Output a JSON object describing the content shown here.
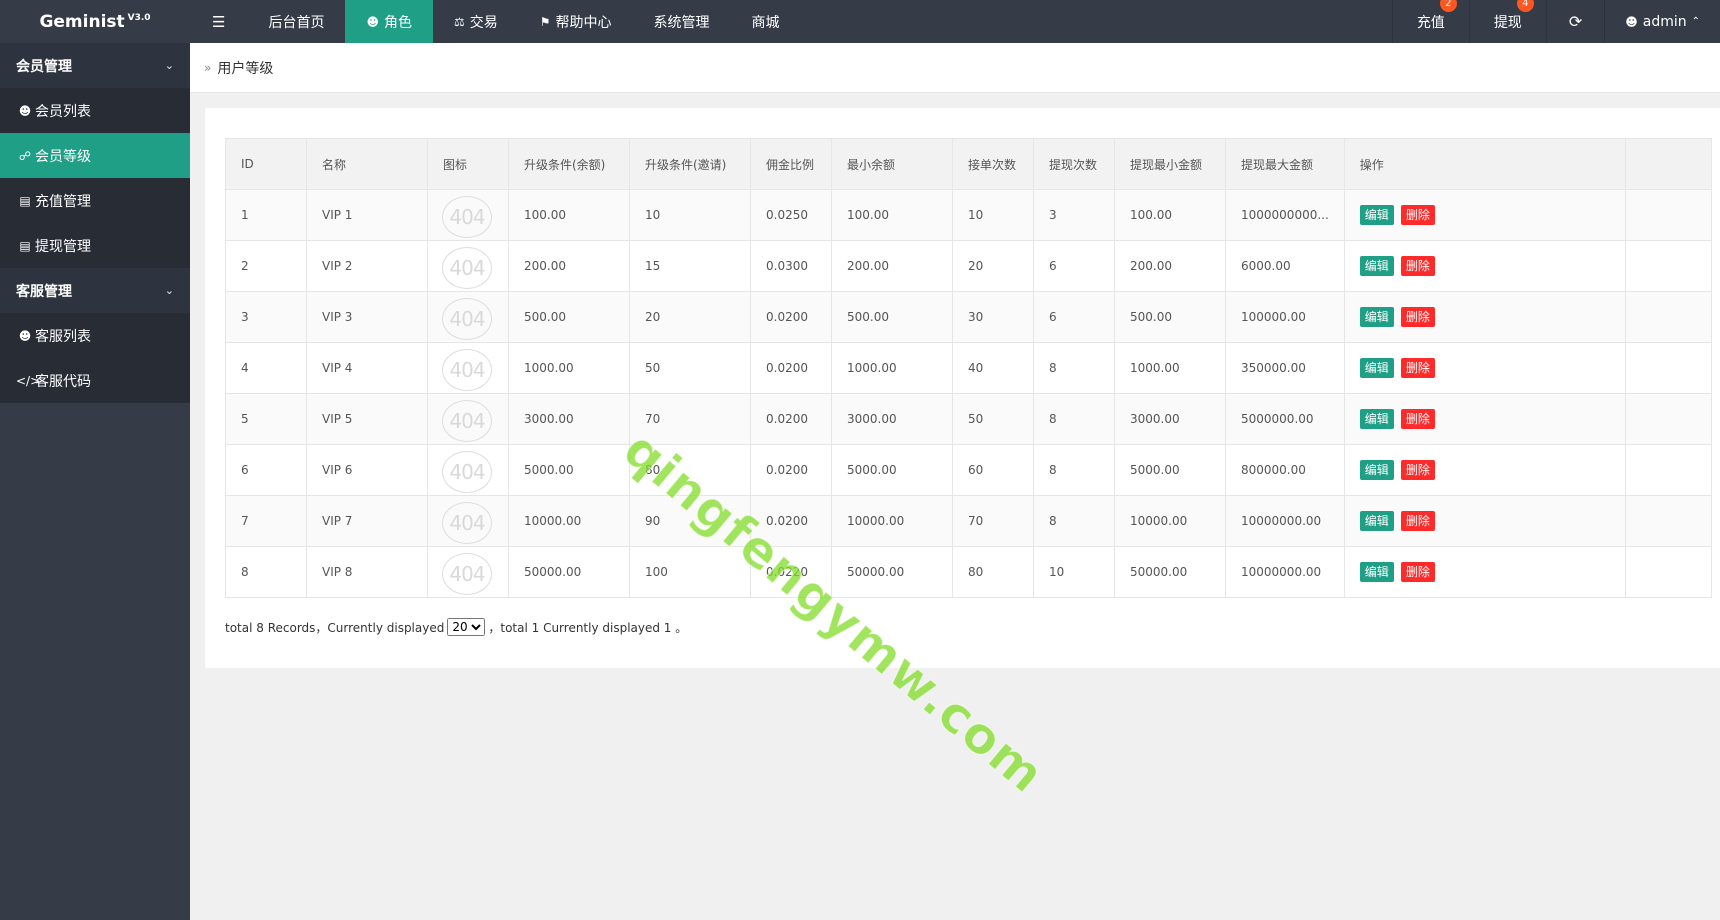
{
  "brand": {
    "name": "Geminist",
    "version": "V3.0"
  },
  "topnav": {
    "toggle_icon": "menu-toggle-icon",
    "items": [
      {
        "label": "后台首页",
        "icon": ""
      },
      {
        "label": "角色",
        "icon": "user-icon",
        "active": true
      },
      {
        "label": "交易",
        "icon": "balance-icon"
      },
      {
        "label": "帮助中心",
        "icon": "flag-icon"
      },
      {
        "label": "系统管理",
        "icon": ""
      },
      {
        "label": "商城",
        "icon": ""
      }
    ]
  },
  "topright": {
    "recharge": {
      "label": "充值",
      "badge": "2"
    },
    "withdraw": {
      "label": "提现",
      "badge": "4"
    },
    "user": "admin"
  },
  "sidebar": {
    "groups": [
      {
        "label": "会员管理",
        "items": [
          {
            "label": "会员列表",
            "icon": "user-icon"
          },
          {
            "label": "会员等级",
            "icon": "link-icon",
            "active": true
          },
          {
            "label": "充值管理",
            "icon": "card-icon"
          },
          {
            "label": "提现管理",
            "icon": "card-icon"
          }
        ]
      },
      {
        "label": "客服管理",
        "items": [
          {
            "label": "客服列表",
            "icon": "users-icon"
          },
          {
            "label": "客服代码",
            "icon": "code-icon"
          }
        ]
      }
    ]
  },
  "breadcrumb": "用户等级",
  "table": {
    "headers": [
      "ID",
      "名称",
      "图标",
      "升级条件(余额)",
      "升级条件(邀请)",
      "佣金比例",
      "最小余额",
      "接单次数",
      "提现次数",
      "提现最小金额",
      "提现最大金额",
      "操作"
    ],
    "icon_placeholder": "404",
    "edit_label": "编辑",
    "delete_label": "删除",
    "rows": [
      [
        "1",
        "VIP 1",
        "100.00",
        "10",
        "0.0250",
        "100.00",
        "10",
        "3",
        "100.00",
        "1000000000..."
      ],
      [
        "2",
        "VIP 2",
        "200.00",
        "15",
        "0.0300",
        "200.00",
        "20",
        "6",
        "200.00",
        "6000.00"
      ],
      [
        "3",
        "VIP 3",
        "500.00",
        "20",
        "0.0200",
        "500.00",
        "30",
        "6",
        "500.00",
        "100000.00"
      ],
      [
        "4",
        "VIP 4",
        "1000.00",
        "50",
        "0.0200",
        "1000.00",
        "40",
        "8",
        "1000.00",
        "350000.00"
      ],
      [
        "5",
        "VIP 5",
        "3000.00",
        "70",
        "0.0200",
        "3000.00",
        "50",
        "8",
        "3000.00",
        "5000000.00"
      ],
      [
        "6",
        "VIP 6",
        "5000.00",
        "80",
        "0.0200",
        "5000.00",
        "60",
        "8",
        "5000.00",
        "800000.00"
      ],
      [
        "7",
        "VIP 7",
        "10000.00",
        "90",
        "0.0200",
        "10000.00",
        "70",
        "8",
        "10000.00",
        "10000000.00"
      ],
      [
        "8",
        "VIP 8",
        "50000.00",
        "100",
        "0.0220",
        "50000.00",
        "80",
        "10",
        "50000.00",
        "10000000.00"
      ]
    ]
  },
  "pager": {
    "prefix": "total 8 Records，Currently displayed",
    "page_size": "20",
    "suffix": "，total 1 Currently displayed 1 。"
  },
  "watermark": "qingfengymw.com",
  "colors": {
    "topbar": "#353c48",
    "accent": "#1e9f86",
    "danger": "#ff2a2a",
    "badge": "#ff5722"
  }
}
